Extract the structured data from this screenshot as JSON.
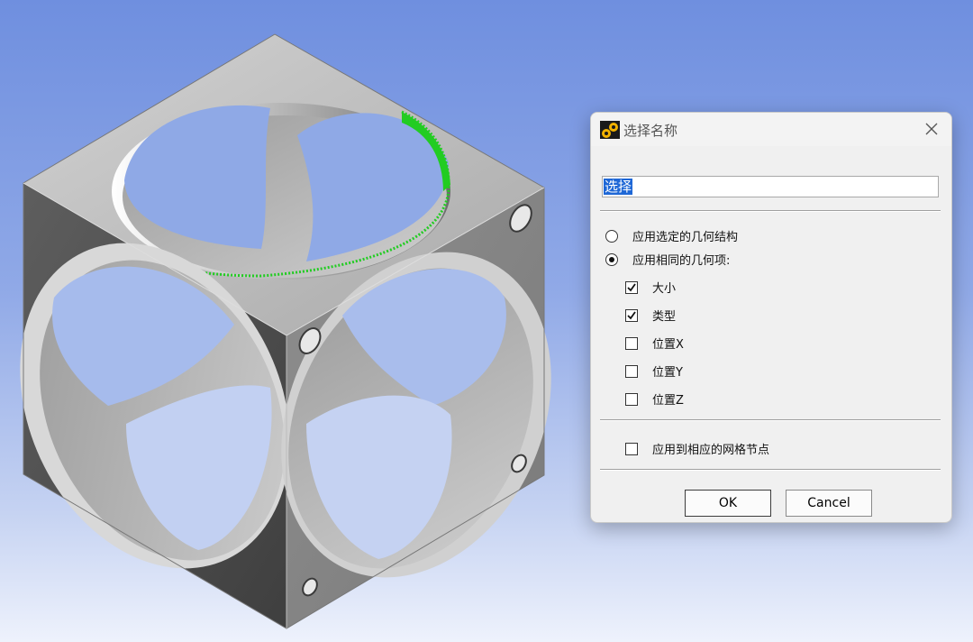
{
  "dialog": {
    "title": "选择名称",
    "close_icon": "close-icon",
    "name_input": {
      "value": "选择"
    },
    "radios": [
      {
        "label": "应用选定的几何结构",
        "checked": false
      },
      {
        "label": "应用相同的几何项:",
        "checked": true
      }
    ],
    "checks": [
      {
        "label": "大小",
        "checked": true
      },
      {
        "label": "类型",
        "checked": true
      },
      {
        "label": "位置X",
        "checked": false
      },
      {
        "label": "位置Y",
        "checked": false
      },
      {
        "label": "位置Z",
        "checked": false
      }
    ],
    "mesh_check": {
      "label": "应用到相应的网格节点",
      "checked": false
    },
    "ok_label": "OK",
    "cancel_label": "Cancel"
  },
  "colors": {
    "selection_highlight": "#22cc22",
    "face_light": "#c4c4c4",
    "face_dark": "#555555",
    "input_selection": "#1e67d6"
  }
}
